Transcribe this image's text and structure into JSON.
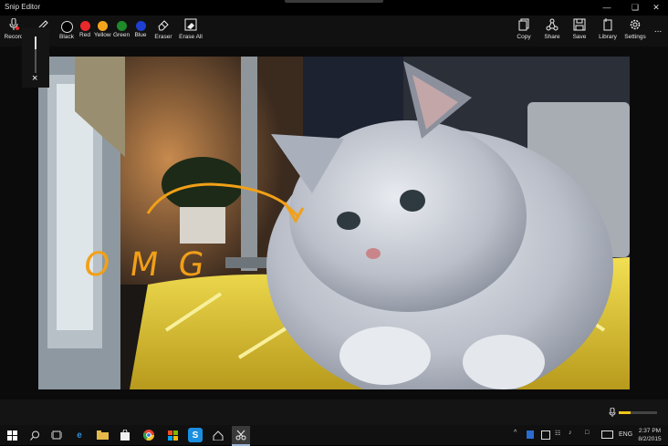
{
  "window": {
    "title": "Snip Editor"
  },
  "toolbar": {
    "record_label": "Record",
    "colors": [
      {
        "label": "Black",
        "color": "#000000"
      },
      {
        "label": "Red",
        "color": "#e8292b"
      },
      {
        "label": "Yellow",
        "color": "#f3a41b"
      },
      {
        "label": "Green",
        "color": "#1f8a2a"
      },
      {
        "label": "Blue",
        "color": "#1f3fd1"
      }
    ],
    "eraser_label": "Eraser",
    "erase_all_label": "Erase All",
    "copy_label": "Copy",
    "share_label": "Share",
    "save_label": "Save",
    "library_label": "Library",
    "settings_label": "Settings",
    "more_label": "..."
  },
  "annotation": {
    "text": "OMG",
    "ink_color": "#f2a017"
  },
  "sidebar_panel": {
    "close_label": "×"
  },
  "status": {
    "audio_level": 0.3
  },
  "taskbar": {
    "lang": "ENG",
    "time": "2:37 PM",
    "date": "8/2/2015"
  }
}
